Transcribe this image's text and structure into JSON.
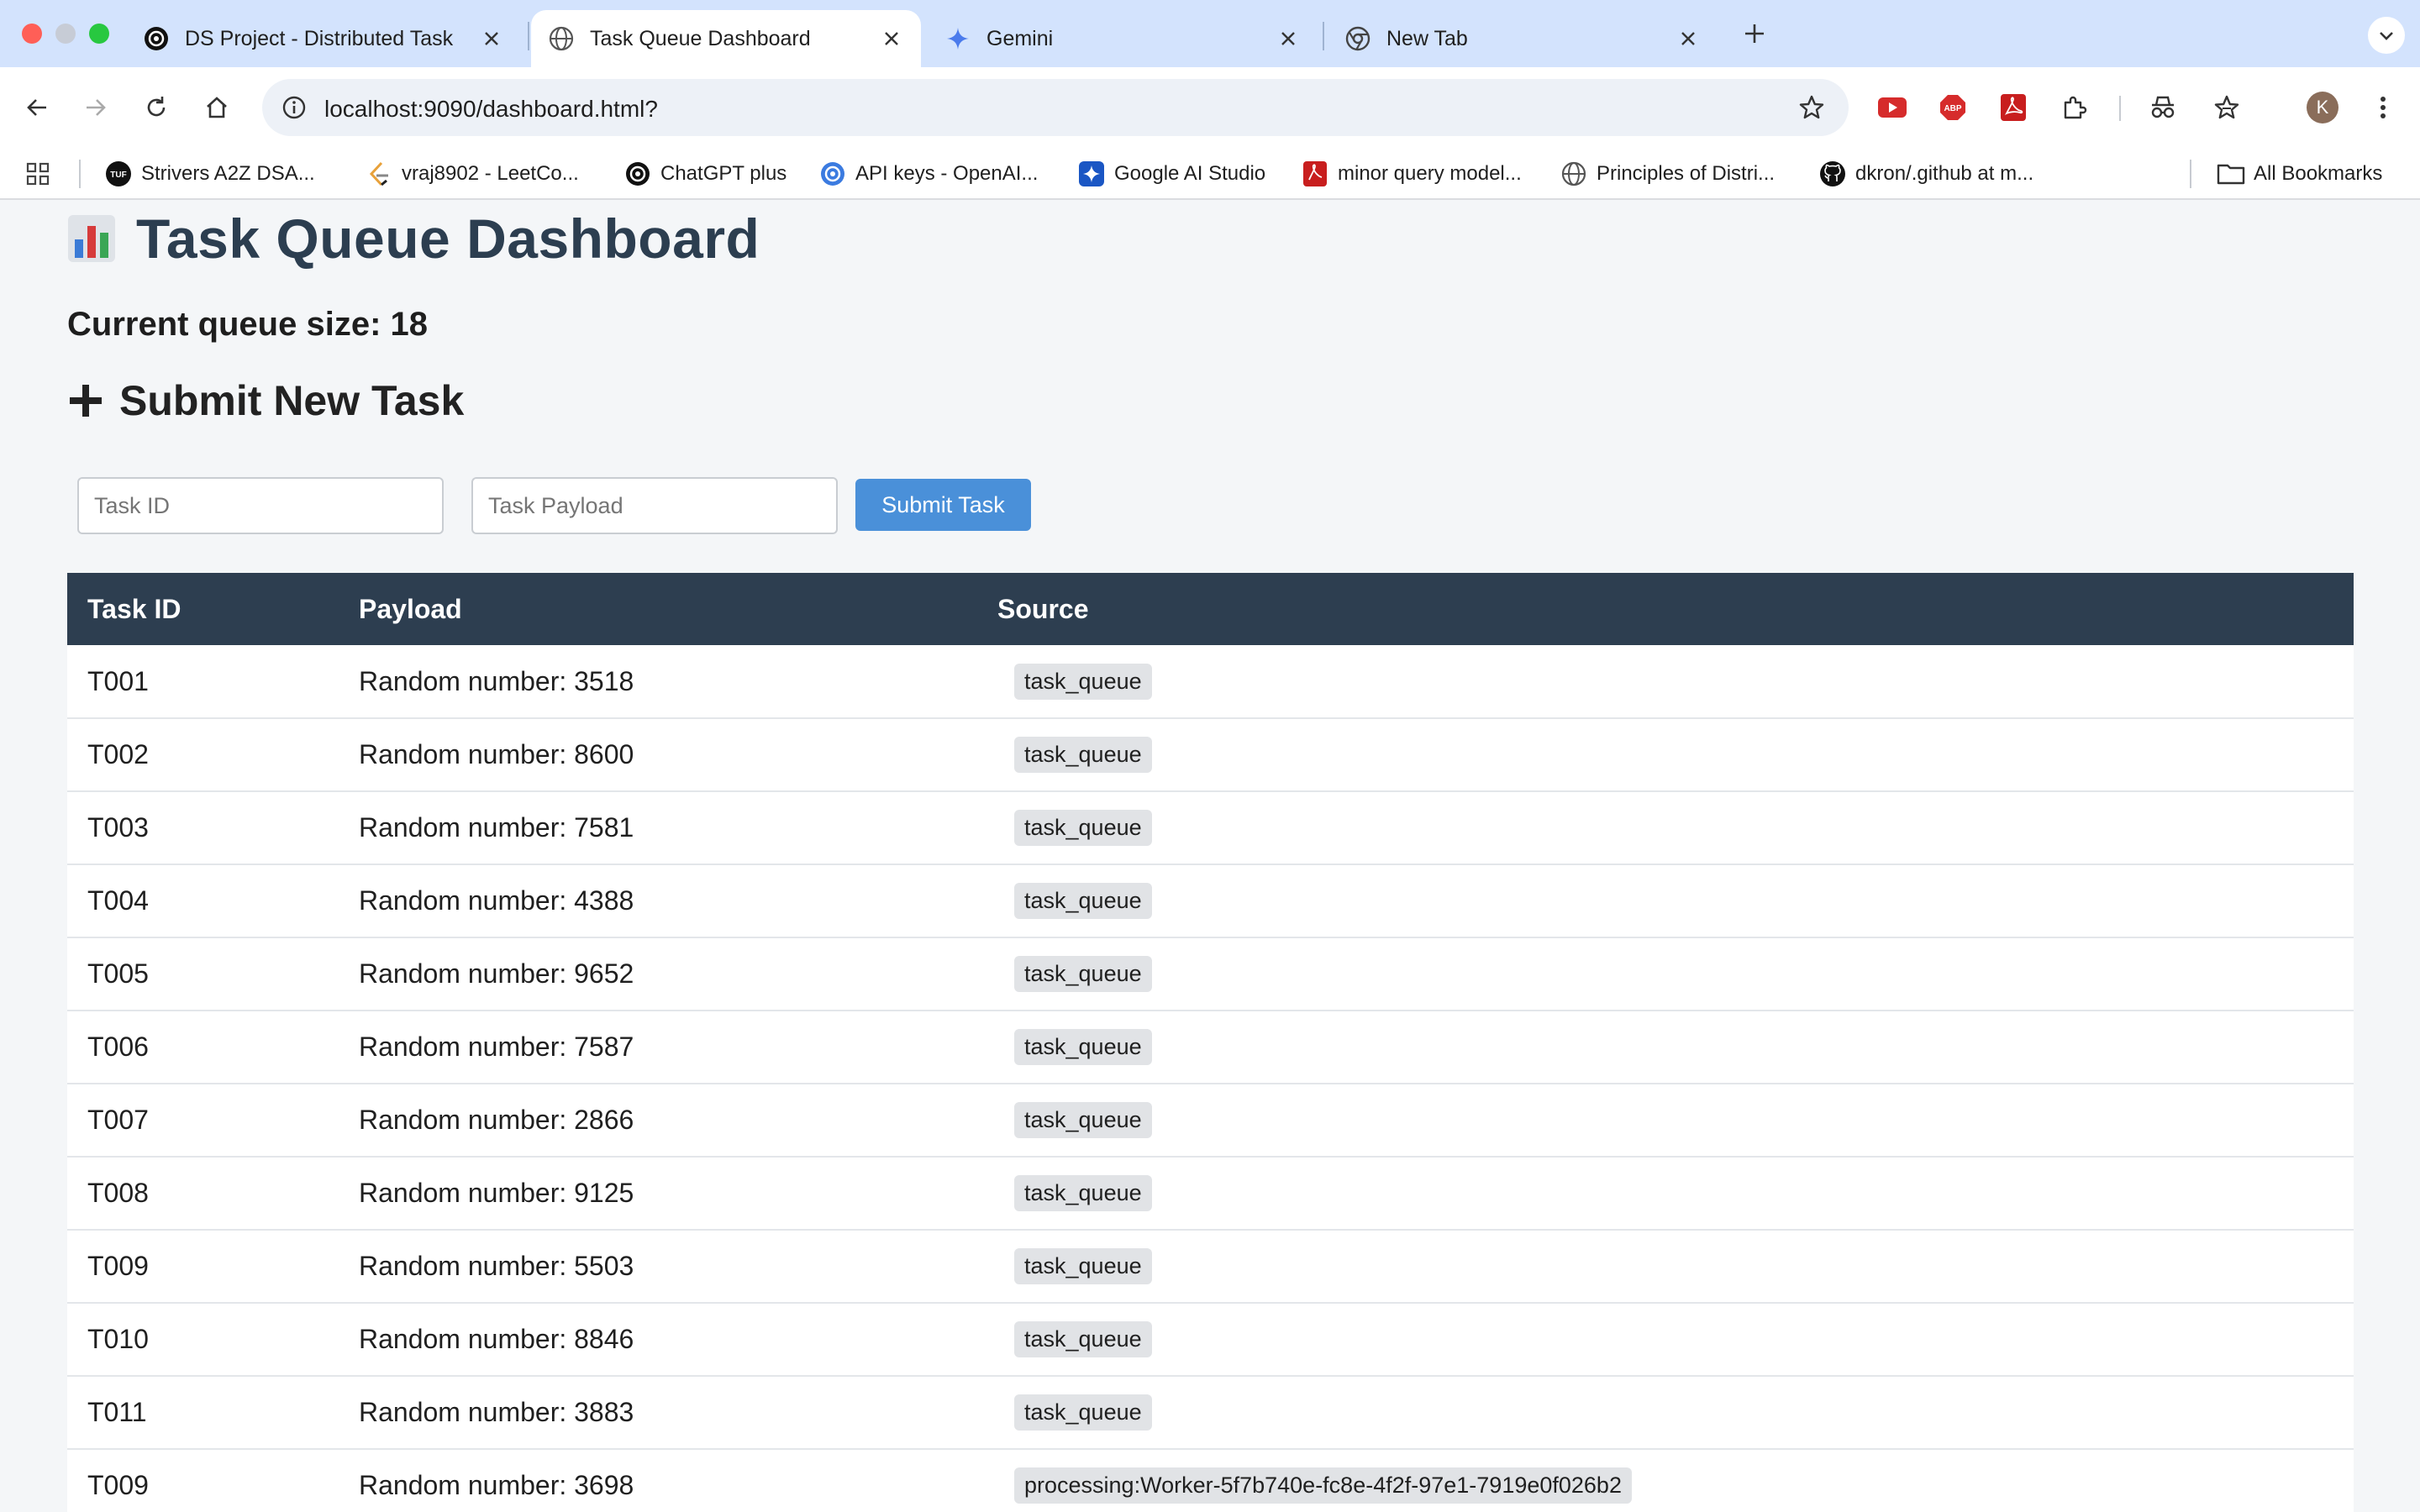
{
  "browser": {
    "tabs": [
      {
        "title": "DS Project - Distributed Task",
        "icon": "openai-icon",
        "active": false
      },
      {
        "title": "Task Queue Dashboard",
        "icon": "globe-icon",
        "active": true
      },
      {
        "title": "Gemini",
        "icon": "gemini-sparkle-icon",
        "active": false
      },
      {
        "title": "New Tab",
        "icon": "chrome-icon",
        "active": false
      }
    ],
    "url": "localhost:9090/dashboard.html?",
    "profile_initial": "K",
    "bookmarks": [
      {
        "label": "Strivers A2Z DSA...",
        "icon": "tuf-icon"
      },
      {
        "label": "vraj8902 - LeetCo...",
        "icon": "leetcode-icon"
      },
      {
        "label": "ChatGPT plus",
        "icon": "openai-icon"
      },
      {
        "label": "API keys - OpenAI...",
        "icon": "openai-blue-icon"
      },
      {
        "label": "Google AI Studio",
        "icon": "ai-studio-icon"
      },
      {
        "label": "minor query model...",
        "icon": "pdf-icon"
      },
      {
        "label": "Principles of Distri...",
        "icon": "globe-icon"
      },
      {
        "label": "dkron/.github at m...",
        "icon": "github-icon"
      }
    ],
    "all_bookmarks_label": "All Bookmarks",
    "colors": {
      "tabbar": "#d3e3fd",
      "toolbar": "#ffffff"
    }
  },
  "page": {
    "title": "Task Queue Dashboard",
    "queue_size_text": "Current queue size: 18",
    "submit_heading": "Submit New Task",
    "form": {
      "task_id_placeholder": "Task ID",
      "payload_placeholder": "Task Payload",
      "submit_label": "Submit Task"
    },
    "table": {
      "headers": [
        "Task ID",
        "Payload",
        "Source"
      ],
      "rows": [
        {
          "id": "T001",
          "payload": "Random number: 3518",
          "source": "task_queue"
        },
        {
          "id": "T002",
          "payload": "Random number: 8600",
          "source": "task_queue"
        },
        {
          "id": "T003",
          "payload": "Random number: 7581",
          "source": "task_queue"
        },
        {
          "id": "T004",
          "payload": "Random number: 4388",
          "source": "task_queue"
        },
        {
          "id": "T005",
          "payload": "Random number: 9652",
          "source": "task_queue"
        },
        {
          "id": "T006",
          "payload": "Random number: 7587",
          "source": "task_queue"
        },
        {
          "id": "T007",
          "payload": "Random number: 2866",
          "source": "task_queue"
        },
        {
          "id": "T008",
          "payload": "Random number: 9125",
          "source": "task_queue"
        },
        {
          "id": "T009",
          "payload": "Random number: 5503",
          "source": "task_queue"
        },
        {
          "id": "T010",
          "payload": "Random number: 8846",
          "source": "task_queue"
        },
        {
          "id": "T011",
          "payload": "Random number: 3883",
          "source": "task_queue"
        },
        {
          "id": "T009",
          "payload": "Random number: 3698",
          "source": "processing:Worker-5f7b740e-fc8e-4f2f-97e1-7919e0f026b2"
        }
      ]
    },
    "colors": {
      "accent": "#4a90d9",
      "header_bg": "#2d3e50",
      "title": "#2c3e50",
      "badge_bg": "#e1e3e6"
    }
  }
}
